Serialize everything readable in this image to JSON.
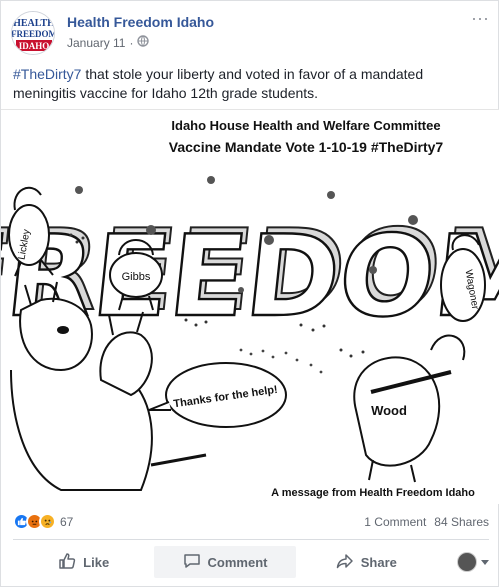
{
  "post": {
    "page_name": "Health Freedom Idaho",
    "date": "January 11",
    "separator": "·",
    "caption_hashtag": "#TheDirty7",
    "caption_text": " that stole your liberty and voted in favor of a mandated meningitis vaccine for Idaho 12th grade students.",
    "avatar_text": [
      "HEALTH",
      "FREEDOM",
      "IDAHO"
    ]
  },
  "image": {
    "title_line1": "Idaho House Health and Welfare Committee",
    "title_line2": "Vaccine Mandate Vote  1-10-19 #TheDirty7",
    "big_word": "FREEDOM",
    "labels": {
      "lickley": "Lickley",
      "gibbs": "Gibbs",
      "wagoner": "Wagoner",
      "wood": "Wood",
      "speech": "Thanks for the help!"
    },
    "footer": "A message from Health Freedom Idaho"
  },
  "stats": {
    "reaction_count": "67",
    "comments": "1 Comment",
    "shares": "84 Shares",
    "reaction_icons": [
      "like-reaction-icon",
      "angry-reaction-icon",
      "sad-reaction-icon"
    ]
  },
  "actions": {
    "like": "Like",
    "comment": "Comment",
    "share": "Share"
  },
  "colors": {
    "link": "#365899",
    "text": "#1d2129",
    "secondary": "#616770",
    "like_blue": "#1877f2",
    "angry_red": "#e9710f",
    "sad_yellow": "#f7b125"
  }
}
